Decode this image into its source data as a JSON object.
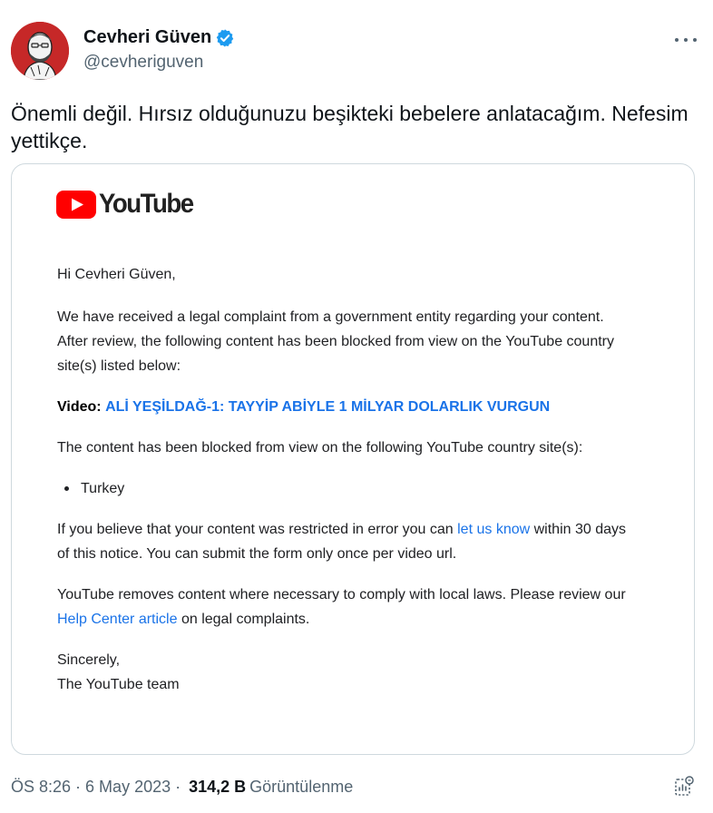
{
  "author": {
    "display_name": "Cevheri Güven",
    "handle": "@cevheriguven",
    "verified": true
  },
  "tweet": {
    "text": "Önemli değil. Hırsız olduğunuzu beşikteki bebelere anlatacağım. Nefesim yettikçe."
  },
  "media": {
    "logo_text": "YouTube",
    "greeting": "Hi Cevheri Güven,",
    "paragraph1": "We have received a legal complaint from a government entity regarding your content. After review, the following content has been blocked from view on the YouTube country site(s) listed below:",
    "video_label": "Video:",
    "video_title": "ALİ YEŞİLDAĞ-1: TAYYİP ABİYLE 1 MİLYAR DOLARLIK VURGUN",
    "paragraph2": "The content has been blocked from view on the following YouTube country site(s):",
    "countries": [
      "Turkey"
    ],
    "p3_before": "If you believe that your content was restricted in error you can",
    "p3_link": "let us know",
    "p3_after": "within 30 days of this notice. You can submit the form only once per video url.",
    "p4_before": "YouTube removes content where necessary to comply with local laws. Please review our",
    "p4_link": "Help Center article",
    "p4_after": "on legal complaints.",
    "closing": "Sincerely,",
    "signature": "The YouTube team"
  },
  "footer": {
    "time": "ÖS 8:26",
    "date": "6 May 2023",
    "separator": "·",
    "views": "314,2 B",
    "views_label": "Görüntülenme"
  },
  "colors": {
    "verified": "#1d9bf0",
    "link": "#1a73e8",
    "youtube_red": "#ff0000",
    "secondary_text": "#536471"
  }
}
